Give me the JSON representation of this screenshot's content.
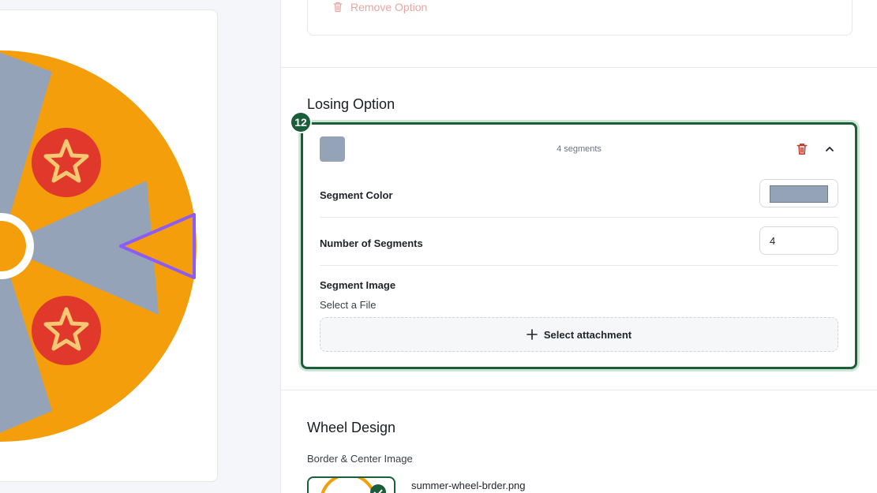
{
  "preview": {
    "colors": {
      "wheel_orange": "#f59e0b",
      "segment_grey": "#95a3b8",
      "star_red": "#e0392b",
      "star_yellow": "#f7c873",
      "pointer_purple": "#8b5cf6"
    },
    "icons": [
      "star-icon",
      "pointer-triangle"
    ]
  },
  "top_card": {
    "remove_label": "Remove Option",
    "icon": "trash-icon"
  },
  "losing_option": {
    "section_title": "Losing Option",
    "step_badge": "12",
    "segments_summary": "4 segments",
    "swatch_color": "#95a3b8",
    "segment_color_label": "Segment Color",
    "segment_color_value": "#95a3b8",
    "number_of_segments_label": "Number of Segments",
    "number_of_segments_value": "4",
    "segment_image_label": "Segment Image",
    "select_file_label": "Select a File",
    "select_attachment_label": "Select attachment"
  },
  "wheel_design": {
    "section_title": "Wheel Design",
    "border_center_label": "Border & Center Image",
    "file_name": "summer-wheel-brder.png"
  },
  "colors": {
    "accent_green": "#1b5e3a",
    "danger_red": "#c0392b"
  }
}
